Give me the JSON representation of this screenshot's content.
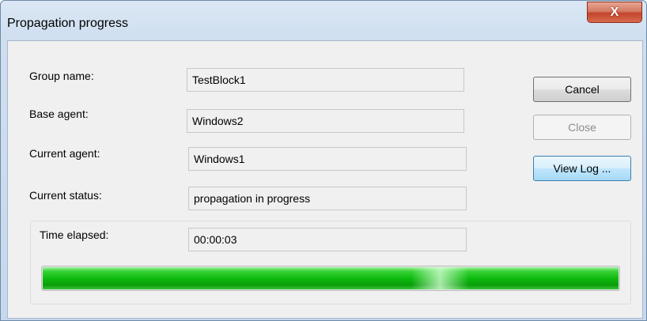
{
  "window": {
    "title": "Propagation progress",
    "close_glyph": "X"
  },
  "fields": {
    "group_name": {
      "label": "Group name:",
      "value": "TestBlock1"
    },
    "base_agent": {
      "label": "Base agent:",
      "value": "Windows2"
    },
    "current_agent": {
      "label": "Current agent:",
      "value": "Windows1"
    },
    "current_status": {
      "label": "Current status:",
      "value": "propagation in progress"
    },
    "time_elapsed": {
      "label": "Time elapsed:",
      "value": "00:00:03"
    }
  },
  "buttons": {
    "cancel": "Cancel",
    "close": "Close",
    "view_log": "View Log ..."
  },
  "progress": {
    "fraction": 1.0,
    "color": "#0fbb0f"
  }
}
